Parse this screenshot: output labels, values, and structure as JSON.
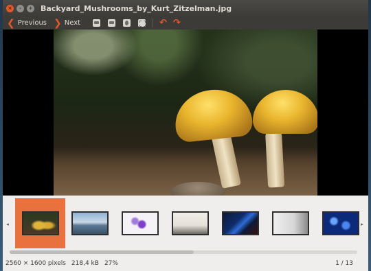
{
  "window": {
    "title": "Backyard_Mushrooms_by_Kurt_Zitzelman.jpg",
    "controls": {
      "close": "×",
      "minimize": "–",
      "maximize": "+"
    }
  },
  "toolbar": {
    "previous_label": "Previous",
    "next_label": "Next",
    "icons": [
      "zoom-normal-icon",
      "zoom-fit-icon",
      "zoom-in-icon",
      "fullscreen-icon",
      "rotate-left-icon",
      "rotate-right-icon"
    ],
    "prev_glyph": "❮",
    "next_glyph": "❯",
    "rotate_left_glyph": "↶",
    "rotate_right_glyph": "↷"
  },
  "filmstrip": {
    "left_arrow": "◂",
    "right_arrow": "▸",
    "thumbnails": [
      {
        "name": "mushrooms",
        "selected": true
      },
      {
        "name": "lake-sky",
        "selected": false
      },
      {
        "name": "purple-flowers",
        "selected": false
      },
      {
        "name": "misty-field",
        "selected": false
      },
      {
        "name": "blue-light-streak",
        "selected": false
      },
      {
        "name": "grey-gradient",
        "selected": false
      },
      {
        "name": "blue-bokeh",
        "selected": false
      }
    ],
    "scroll_position": 0.53
  },
  "status": {
    "dimensions": "2560 × 1600 pixels",
    "file_size": "218,4 kB",
    "zoom": "27%",
    "position": "1 / 13"
  },
  "colors": {
    "accent": "#e9713d",
    "titlebar": "#3c3b37",
    "strip_bg": "#efeeec"
  }
}
